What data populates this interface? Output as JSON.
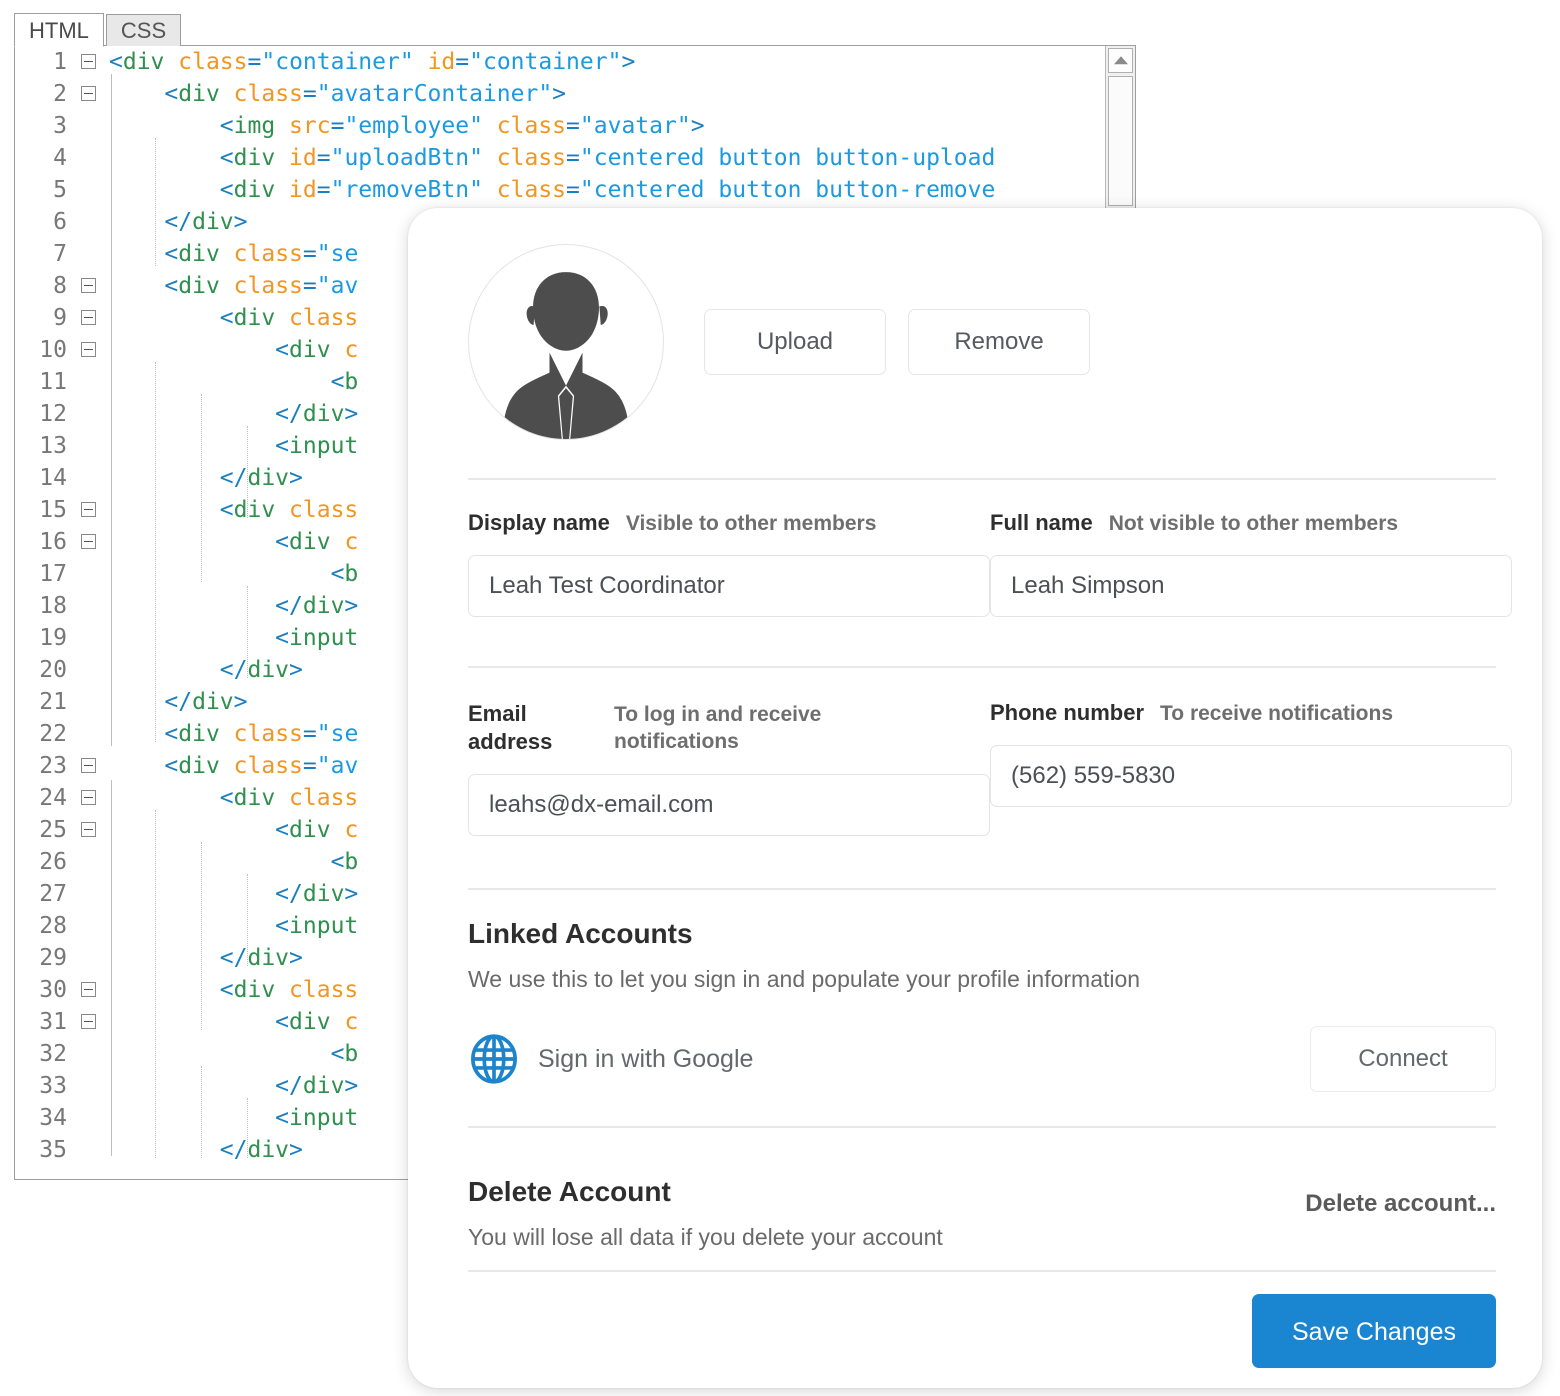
{
  "editor": {
    "tabs": [
      {
        "label": "HTML",
        "active": true
      },
      {
        "label": "CSS",
        "active": false
      }
    ],
    "lines": [
      {
        "n": "1",
        "fold": true,
        "indent": 1,
        "segments": [
          {
            "t": "brk",
            "s": "<"
          },
          {
            "t": "tag",
            "s": "div"
          },
          {
            "t": "plain",
            "s": " "
          },
          {
            "t": "attr",
            "s": "class"
          },
          {
            "t": "brk",
            "s": "="
          },
          {
            "t": "val",
            "s": "\"container\""
          },
          {
            "t": "plain",
            "s": " "
          },
          {
            "t": "attr",
            "s": "id"
          },
          {
            "t": "brk",
            "s": "="
          },
          {
            "t": "val",
            "s": "\"container\""
          },
          {
            "t": "brk",
            "s": ">"
          }
        ]
      },
      {
        "n": "2",
        "fold": true,
        "indent": 2,
        "segments": [
          {
            "t": "brk",
            "s": "<"
          },
          {
            "t": "tag",
            "s": "div"
          },
          {
            "t": "plain",
            "s": " "
          },
          {
            "t": "attr",
            "s": "class"
          },
          {
            "t": "brk",
            "s": "="
          },
          {
            "t": "val",
            "s": "\"avatarContainer\""
          },
          {
            "t": "brk",
            "s": ">"
          }
        ]
      },
      {
        "n": "3",
        "fold": false,
        "indent": 3,
        "segments": [
          {
            "t": "brk",
            "s": "<"
          },
          {
            "t": "tag",
            "s": "img"
          },
          {
            "t": "plain",
            "s": " "
          },
          {
            "t": "attr",
            "s": "src"
          },
          {
            "t": "brk",
            "s": "="
          },
          {
            "t": "val",
            "s": "\"employee\""
          },
          {
            "t": "plain",
            "s": " "
          },
          {
            "t": "attr",
            "s": "class"
          },
          {
            "t": "brk",
            "s": "="
          },
          {
            "t": "val",
            "s": "\"avatar\""
          },
          {
            "t": "brk",
            "s": ">"
          }
        ]
      },
      {
        "n": "4",
        "fold": false,
        "indent": 3,
        "segments": [
          {
            "t": "brk",
            "s": "<"
          },
          {
            "t": "tag",
            "s": "div"
          },
          {
            "t": "plain",
            "s": " "
          },
          {
            "t": "attr",
            "s": "id"
          },
          {
            "t": "brk",
            "s": "="
          },
          {
            "t": "val",
            "s": "\"uploadBtn\""
          },
          {
            "t": "plain",
            "s": " "
          },
          {
            "t": "attr",
            "s": "class"
          },
          {
            "t": "brk",
            "s": "="
          },
          {
            "t": "val",
            "s": "\"centered button button-upload"
          }
        ]
      },
      {
        "n": "5",
        "fold": false,
        "indent": 3,
        "segments": [
          {
            "t": "brk",
            "s": "<"
          },
          {
            "t": "tag",
            "s": "div"
          },
          {
            "t": "plain",
            "s": " "
          },
          {
            "t": "attr",
            "s": "id"
          },
          {
            "t": "brk",
            "s": "="
          },
          {
            "t": "val",
            "s": "\"removeBtn\""
          },
          {
            "t": "plain",
            "s": " "
          },
          {
            "t": "attr",
            "s": "class"
          },
          {
            "t": "brk",
            "s": "="
          },
          {
            "t": "val",
            "s": "\"centered button button-remove"
          }
        ]
      },
      {
        "n": "6",
        "fold": false,
        "indent": 2,
        "segments": [
          {
            "t": "brk",
            "s": "</"
          },
          {
            "t": "tag",
            "s": "div"
          },
          {
            "t": "brk",
            "s": ">"
          }
        ]
      },
      {
        "n": "7",
        "fold": false,
        "indent": 2,
        "segments": [
          {
            "t": "brk",
            "s": "<"
          },
          {
            "t": "tag",
            "s": "div"
          },
          {
            "t": "plain",
            "s": " "
          },
          {
            "t": "attr",
            "s": "class"
          },
          {
            "t": "brk",
            "s": "="
          },
          {
            "t": "val",
            "s": "\"se"
          }
        ]
      },
      {
        "n": "8",
        "fold": true,
        "indent": 2,
        "segments": [
          {
            "t": "brk",
            "s": "<"
          },
          {
            "t": "tag",
            "s": "div"
          },
          {
            "t": "plain",
            "s": " "
          },
          {
            "t": "attr",
            "s": "class"
          },
          {
            "t": "brk",
            "s": "="
          },
          {
            "t": "val",
            "s": "\"av"
          }
        ]
      },
      {
        "n": "9",
        "fold": true,
        "indent": 3,
        "segments": [
          {
            "t": "brk",
            "s": "<"
          },
          {
            "t": "tag",
            "s": "div"
          },
          {
            "t": "plain",
            "s": " "
          },
          {
            "t": "attr",
            "s": "class"
          }
        ]
      },
      {
        "n": "10",
        "fold": true,
        "indent": 4,
        "segments": [
          {
            "t": "brk",
            "s": "<"
          },
          {
            "t": "tag",
            "s": "div"
          },
          {
            "t": "plain",
            "s": " "
          },
          {
            "t": "attr",
            "s": "c"
          }
        ]
      },
      {
        "n": "11",
        "fold": false,
        "indent": 5,
        "segments": [
          {
            "t": "brk",
            "s": "<"
          },
          {
            "t": "tag",
            "s": "b"
          }
        ]
      },
      {
        "n": "12",
        "fold": false,
        "indent": 4,
        "segments": [
          {
            "t": "brk",
            "s": "</"
          },
          {
            "t": "tag",
            "s": "div"
          },
          {
            "t": "brk",
            "s": ">"
          }
        ]
      },
      {
        "n": "13",
        "fold": false,
        "indent": 4,
        "segments": [
          {
            "t": "brk",
            "s": "<"
          },
          {
            "t": "tag",
            "s": "input"
          }
        ]
      },
      {
        "n": "14",
        "fold": false,
        "indent": 3,
        "segments": [
          {
            "t": "brk",
            "s": "</"
          },
          {
            "t": "tag",
            "s": "div"
          },
          {
            "t": "brk",
            "s": ">"
          }
        ]
      },
      {
        "n": "15",
        "fold": true,
        "indent": 3,
        "segments": [
          {
            "t": "brk",
            "s": "<"
          },
          {
            "t": "tag",
            "s": "div"
          },
          {
            "t": "plain",
            "s": " "
          },
          {
            "t": "attr",
            "s": "class"
          }
        ]
      },
      {
        "n": "16",
        "fold": true,
        "indent": 4,
        "segments": [
          {
            "t": "brk",
            "s": "<"
          },
          {
            "t": "tag",
            "s": "div"
          },
          {
            "t": "plain",
            "s": " "
          },
          {
            "t": "attr",
            "s": "c"
          }
        ]
      },
      {
        "n": "17",
        "fold": false,
        "indent": 5,
        "segments": [
          {
            "t": "brk",
            "s": "<"
          },
          {
            "t": "tag",
            "s": "b"
          }
        ]
      },
      {
        "n": "18",
        "fold": false,
        "indent": 4,
        "segments": [
          {
            "t": "brk",
            "s": "</"
          },
          {
            "t": "tag",
            "s": "div"
          },
          {
            "t": "brk",
            "s": ">"
          }
        ]
      },
      {
        "n": "19",
        "fold": false,
        "indent": 4,
        "segments": [
          {
            "t": "brk",
            "s": "<"
          },
          {
            "t": "tag",
            "s": "input"
          }
        ]
      },
      {
        "n": "20",
        "fold": false,
        "indent": 3,
        "segments": [
          {
            "t": "brk",
            "s": "</"
          },
          {
            "t": "tag",
            "s": "div"
          },
          {
            "t": "brk",
            "s": ">"
          }
        ]
      },
      {
        "n": "21",
        "fold": false,
        "indent": 2,
        "segments": [
          {
            "t": "brk",
            "s": "</"
          },
          {
            "t": "tag",
            "s": "div"
          },
          {
            "t": "brk",
            "s": ">"
          }
        ]
      },
      {
        "n": "22",
        "fold": false,
        "indent": 2,
        "segments": [
          {
            "t": "brk",
            "s": "<"
          },
          {
            "t": "tag",
            "s": "div"
          },
          {
            "t": "plain",
            "s": " "
          },
          {
            "t": "attr",
            "s": "class"
          },
          {
            "t": "brk",
            "s": "="
          },
          {
            "t": "val",
            "s": "\"se"
          }
        ]
      },
      {
        "n": "23",
        "fold": true,
        "indent": 2,
        "segments": [
          {
            "t": "brk",
            "s": "<"
          },
          {
            "t": "tag",
            "s": "div"
          },
          {
            "t": "plain",
            "s": " "
          },
          {
            "t": "attr",
            "s": "class"
          },
          {
            "t": "brk",
            "s": "="
          },
          {
            "t": "val",
            "s": "\"av"
          }
        ]
      },
      {
        "n": "24",
        "fold": true,
        "indent": 3,
        "segments": [
          {
            "t": "brk",
            "s": "<"
          },
          {
            "t": "tag",
            "s": "div"
          },
          {
            "t": "plain",
            "s": " "
          },
          {
            "t": "attr",
            "s": "class"
          }
        ]
      },
      {
        "n": "25",
        "fold": true,
        "indent": 4,
        "segments": [
          {
            "t": "brk",
            "s": "<"
          },
          {
            "t": "tag",
            "s": "div"
          },
          {
            "t": "plain",
            "s": " "
          },
          {
            "t": "attr",
            "s": "c"
          }
        ]
      },
      {
        "n": "26",
        "fold": false,
        "indent": 5,
        "segments": [
          {
            "t": "brk",
            "s": "<"
          },
          {
            "t": "tag",
            "s": "b"
          }
        ]
      },
      {
        "n": "27",
        "fold": false,
        "indent": 4,
        "segments": [
          {
            "t": "brk",
            "s": "</"
          },
          {
            "t": "tag",
            "s": "div"
          },
          {
            "t": "brk",
            "s": ">"
          }
        ]
      },
      {
        "n": "28",
        "fold": false,
        "indent": 4,
        "segments": [
          {
            "t": "brk",
            "s": "<"
          },
          {
            "t": "tag",
            "s": "input"
          }
        ]
      },
      {
        "n": "29",
        "fold": false,
        "indent": 3,
        "segments": [
          {
            "t": "brk",
            "s": "</"
          },
          {
            "t": "tag",
            "s": "div"
          },
          {
            "t": "brk",
            "s": ">"
          }
        ]
      },
      {
        "n": "30",
        "fold": true,
        "indent": 3,
        "segments": [
          {
            "t": "brk",
            "s": "<"
          },
          {
            "t": "tag",
            "s": "div"
          },
          {
            "t": "plain",
            "s": " "
          },
          {
            "t": "attr",
            "s": "class"
          }
        ]
      },
      {
        "n": "31",
        "fold": true,
        "indent": 4,
        "segments": [
          {
            "t": "brk",
            "s": "<"
          },
          {
            "t": "tag",
            "s": "div"
          },
          {
            "t": "plain",
            "s": " "
          },
          {
            "t": "attr",
            "s": "c"
          }
        ]
      },
      {
        "n": "32",
        "fold": false,
        "indent": 5,
        "segments": [
          {
            "t": "brk",
            "s": "<"
          },
          {
            "t": "tag",
            "s": "b"
          }
        ]
      },
      {
        "n": "33",
        "fold": false,
        "indent": 4,
        "segments": [
          {
            "t": "brk",
            "s": "</"
          },
          {
            "t": "tag",
            "s": "div"
          },
          {
            "t": "brk",
            "s": ">"
          }
        ]
      },
      {
        "n": "34",
        "fold": false,
        "indent": 4,
        "segments": [
          {
            "t": "brk",
            "s": "<"
          },
          {
            "t": "tag",
            "s": "input"
          }
        ]
      },
      {
        "n": "35",
        "fold": false,
        "indent": 3,
        "segments": [
          {
            "t": "brk",
            "s": "</"
          },
          {
            "t": "tag",
            "s": "div"
          },
          {
            "t": "brk",
            "s": ">"
          }
        ]
      }
    ]
  },
  "modal": {
    "avatar": {
      "icon": "businessman-avatar-icon",
      "upload_label": "Upload",
      "remove_label": "Remove"
    },
    "fields": {
      "display_name": {
        "label": "Display name",
        "hint": "Visible to other members",
        "value": "Leah Test Coordinator"
      },
      "full_name": {
        "label": "Full name",
        "hint": "Not visible to other members",
        "value": "Leah Simpson"
      },
      "email_address": {
        "label": "Email address",
        "hint": "To log in and receive notifications",
        "value": "leahs@dx-email.com"
      },
      "phone_number": {
        "label": "Phone number",
        "hint": "To receive notifications",
        "value": "(562) 559-5830"
      }
    },
    "linked_accounts": {
      "title": "Linked Accounts",
      "subtitle": "We use this to let you sign in and populate your profile information",
      "provider_icon": "globe-icon",
      "provider_label": "Sign in with Google",
      "connect_label": "Connect"
    },
    "delete_account": {
      "title": "Delete Account",
      "subtitle": "You will lose all data if you delete your account",
      "link_label": "Delete account..."
    },
    "save_label": "Save Changes",
    "accent_color": "#1a85d0"
  }
}
